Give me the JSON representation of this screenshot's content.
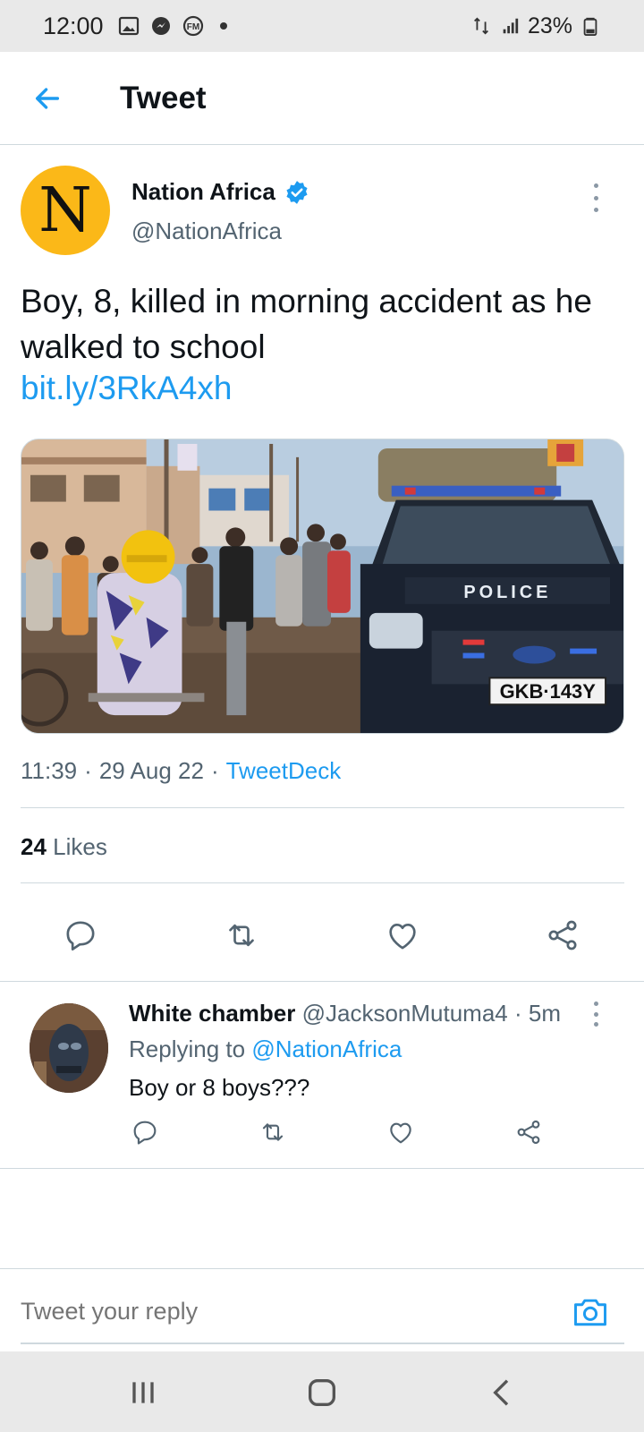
{
  "status_bar": {
    "time": "12:00",
    "battery": "23%",
    "icons": [
      "gallery-icon",
      "messenger-icon",
      "fm-icon",
      "notification-dot",
      "data-transfer-icon",
      "signal-icon",
      "battery-icon"
    ]
  },
  "header": {
    "title": "Tweet"
  },
  "tweet": {
    "author_name": "Nation Africa",
    "author_handle": "@NationAfrica",
    "avatar_letter": "N",
    "text": "Boy, 8, killed in morning accident as he walked to school",
    "link": "bit.ly/3RkA4xh",
    "photo": {
      "sign_text": "POLICE",
      "plate_text": "GKB·143Y"
    },
    "time": "11:39",
    "date": "29 Aug 22",
    "source": "TweetDeck",
    "likes_count": "24",
    "likes_label": "Likes"
  },
  "reply": {
    "name": "White chamber",
    "handle": "@JacksonMutuma4",
    "age": "5m",
    "replying_prefix": "Replying to",
    "replying_to": "@NationAfrica",
    "text": "Boy or 8 boys???"
  },
  "compose": {
    "placeholder": "Tweet your reply"
  },
  "colors": {
    "accent": "#1d9bf0",
    "avatar_bg": "#fbb818",
    "secondary_text": "#536471",
    "divider": "#cfd9de"
  }
}
